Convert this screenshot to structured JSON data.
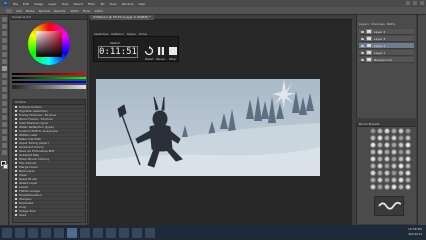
{
  "menubar": {
    "logo": "Ps",
    "items": [
      "File",
      "Edit",
      "Image",
      "Layer",
      "Type",
      "Select",
      "Filter",
      "3D",
      "View",
      "Window",
      "Help"
    ]
  },
  "optionsbar": {
    "brush_size": "120",
    "mode_label": "Mode:",
    "mode_value": "Normal",
    "opacity_label": "Opacity:",
    "opacity_value": "100%",
    "flow_label": "Flow:",
    "flow_value": "100%"
  },
  "leftpanel": {
    "color_head": "Coolorus 2.5",
    "actions_head": "Actions",
    "actions": [
      "Default Actions",
      "Vignette (selection)",
      "Frame Channel - 50 pixel",
      "Wood Frame - 50 pixel",
      "Cast Shadow (type)",
      "Water Reflection (type)",
      "Custom RGB to Grayscale",
      "Molten Lead",
      "Make Clip Path",
      "Sepia Toning (layer)",
      "Quadrant Colors",
      "Save As Photoshop PDF",
      "Gradient Map",
      "Mixer Brush Cloning",
      "Flip Canvas",
      "Merge Down",
      "New Layer",
      "Clear",
      "Reset Brush",
      "Select Layer",
      "Levels",
      "Flatten Image",
      "Hue/Saturation",
      "Sharpen",
      "Duplicate",
      "Crop",
      "Image Size",
      "Save"
    ]
  },
  "document": {
    "tab_title": "Untitled-1 @ 33.3% (Layer 4, RGB/8) *"
  },
  "timer": {
    "tabs": [
      "Swatches",
      "Patterns",
      "Styles",
      "Timer"
    ],
    "name": "Sketch",
    "time": "0:11:51",
    "reset_label": "Reset",
    "pause_label": "Pause",
    "stop_label": "Stop"
  },
  "layers": {
    "tabs": [
      "Layers",
      "Channels",
      "Paths"
    ],
    "items": [
      {
        "name": "Layer 4",
        "selected": false
      },
      {
        "name": "Layer 3",
        "selected": false
      },
      {
        "name": "Layer 2",
        "selected": true
      },
      {
        "name": "Layer 1",
        "selected": false
      },
      {
        "name": "Background",
        "selected": false
      }
    ]
  },
  "brushes": {
    "head": "Brush Presets"
  },
  "taskbar": {
    "time": "10:58 PM",
    "date": "8/6/2014"
  },
  "colors": {
    "sky": "#b7c6d2",
    "snow": "#c9d6de",
    "trees": "#4c5e6e",
    "figure": "#2a2f38",
    "accent": "#4f6c8c"
  }
}
